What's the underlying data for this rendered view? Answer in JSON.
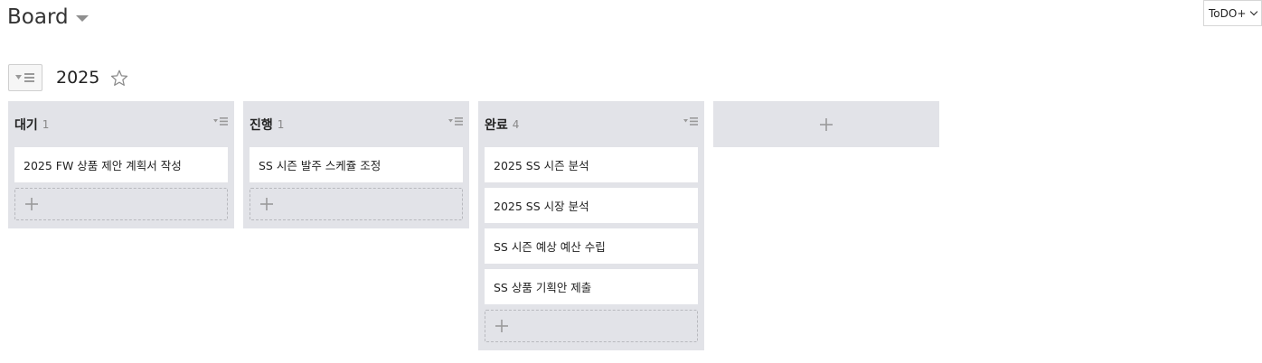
{
  "header": {
    "board_title": "Board",
    "view_select": "ToDO+"
  },
  "section": {
    "title": "2025"
  },
  "columns": [
    {
      "name": "대기",
      "count": "1",
      "cards": [
        "2025 FW 상품 제안 계획서 작성"
      ]
    },
    {
      "name": "진행",
      "count": "1",
      "cards": [
        "SS 시즌 발주 스케쥴 조정"
      ]
    },
    {
      "name": "완료",
      "count": "4",
      "cards": [
        "2025 SS 시즌 분석",
        "2025 SS 시장 분석",
        "SS 시즌 예상 예산 수립",
        "SS 상품 기획안 제출"
      ]
    }
  ],
  "icons": {
    "caret": "caret-down-icon",
    "filter": "filter-list-icon",
    "star": "star-outline-icon",
    "column_menu": "column-menu-icon",
    "add": "plus-icon"
  },
  "colors": {
    "column_bg": "#e2e3e8",
    "card_bg": "#ffffff",
    "icon_gray": "#9a9a9a"
  }
}
